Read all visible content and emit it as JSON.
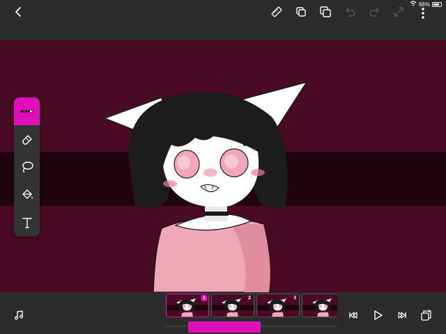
{
  "theme": {
    "accent": "#e10fbb",
    "toolbar": "#2b2b2b",
    "canvas_bg": "#4a0a24"
  },
  "status": {
    "battery": "66%",
    "battery_level": 0.66,
    "icons": [
      "wifi-icon",
      "battery-icon"
    ]
  },
  "toolbar": {
    "icons": [
      "back-chevron-icon",
      "ruler-icon",
      "duplicate-frame-icon",
      "layers-icon",
      "undo-icon",
      "redo-icon",
      "expand-icon",
      "more-options-icon"
    ],
    "disabled": [
      "undo-icon",
      "redo-icon",
      "expand-icon"
    ]
  },
  "tools": [
    {
      "name": "brush",
      "icon": "brush-icon",
      "active": true
    },
    {
      "name": "eraser",
      "icon": "eraser-icon",
      "active": false
    },
    {
      "name": "lasso",
      "icon": "lasso-icon",
      "active": false
    },
    {
      "name": "fill",
      "icon": "fill-bucket-icon",
      "active": false
    },
    {
      "name": "text",
      "icon": "text-tool-icon",
      "active": false
    }
  ],
  "timeline": {
    "frames": [
      {
        "number": "1",
        "selected": true
      },
      {
        "number": "2",
        "selected": false
      },
      {
        "number": "3",
        "selected": false
      },
      {
        "number": "",
        "selected": false
      }
    ],
    "controls": [
      "music-icon",
      "skip-back-icon",
      "play-icon",
      "skip-forward-icon",
      "onion-skin-icon"
    ]
  }
}
